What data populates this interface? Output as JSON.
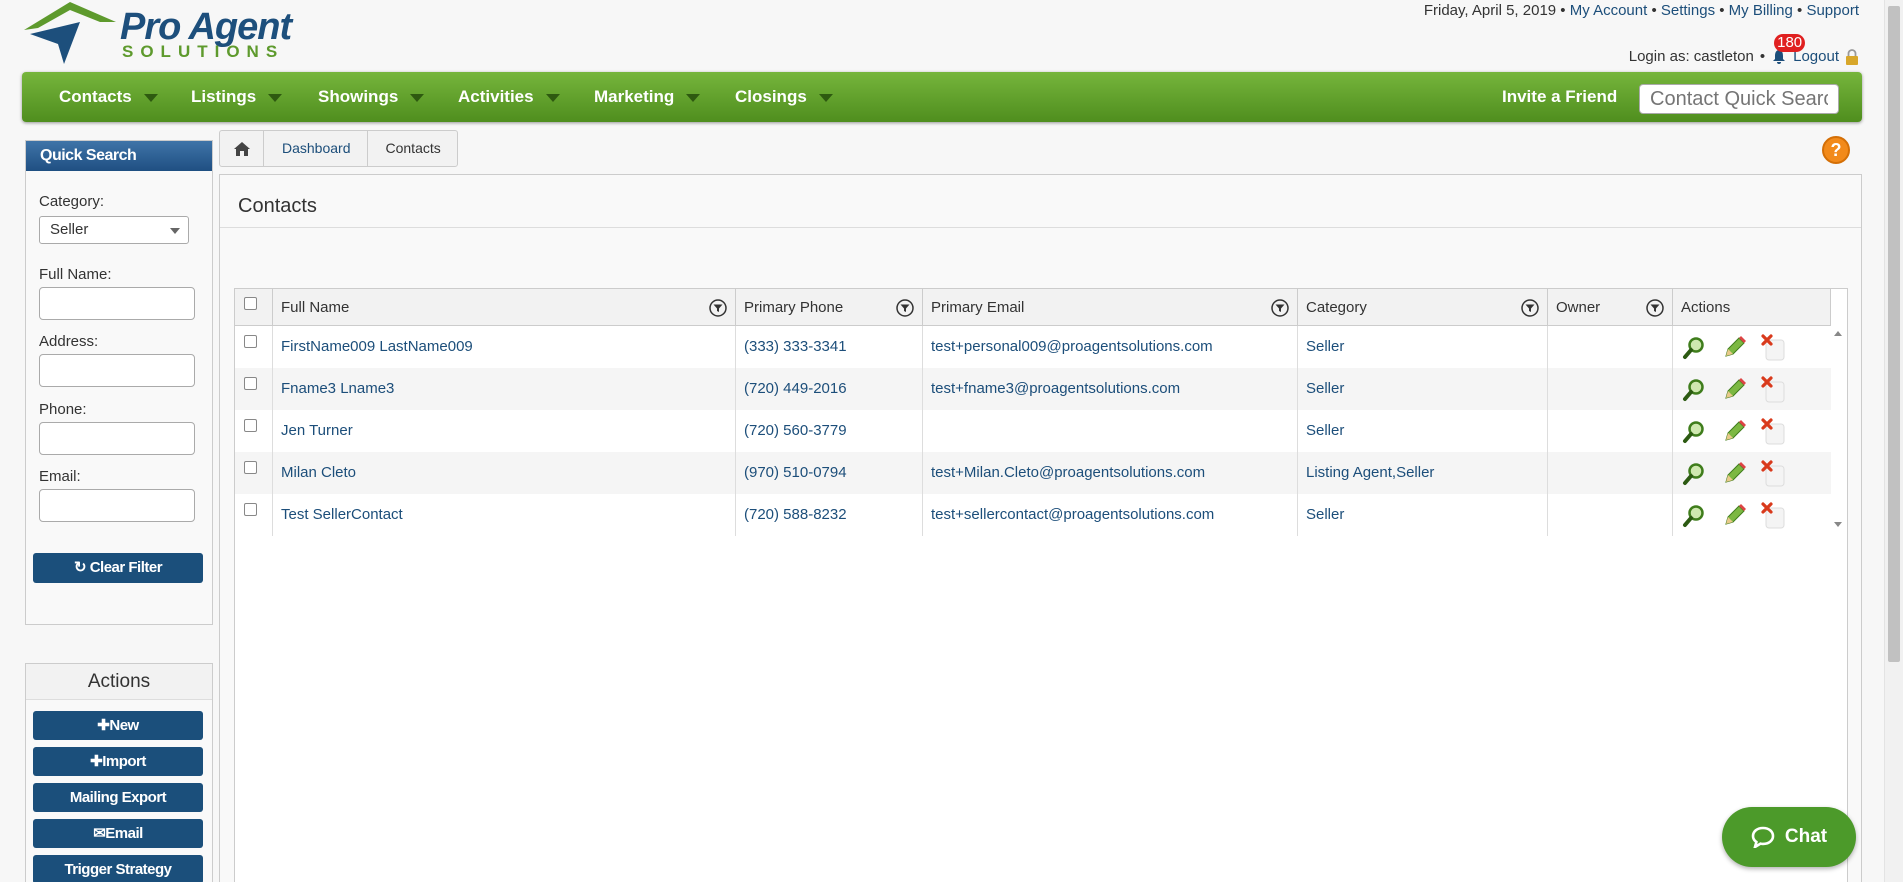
{
  "header": {
    "logo_name": "Pro Agent",
    "logo_sub": "SOLUTIONS",
    "date": "Friday, April 5, 2019",
    "links": [
      "My Account",
      "Settings",
      "My Billing",
      "Support"
    ],
    "login_text": "Login as: castleton",
    "notification_count": "180",
    "logout": "Logout"
  },
  "nav": {
    "items": [
      "Contacts",
      "Listings",
      "Showings",
      "Activities",
      "Marketing",
      "Closings"
    ],
    "invite": "Invite a Friend",
    "search_placeholder": "Contact Quick Search"
  },
  "quick_search": {
    "title": "Quick Search",
    "category_label": "Category:",
    "category_value": "Seller",
    "fullname_label": "Full Name:",
    "address_label": "Address:",
    "phone_label": "Phone:",
    "email_label": "Email:",
    "clear_filter": "Clear Filter"
  },
  "actions": {
    "title": "Actions",
    "new": "New",
    "import": "Import",
    "mailing_export": "Mailing Export",
    "email": "Email",
    "trigger_strategy": "Trigger Strategy"
  },
  "breadcrumb": [
    "Dashboard",
    "Contacts"
  ],
  "help_symbol": "?",
  "page_title": "Contacts",
  "grid": {
    "columns": [
      "Full Name",
      "Primary Phone",
      "Primary Email",
      "Category",
      "Owner",
      "Actions"
    ],
    "rows": [
      {
        "name": "FirstName009 LastName009",
        "phone": "(333) 333-3341",
        "email": "test+personal009@proagentsolutions.com",
        "category": "Seller",
        "owner": ""
      },
      {
        "name": "Fname3 Lname3",
        "phone": "(720) 449-2016",
        "email": "test+fname3@proagentsolutions.com",
        "category": "Seller",
        "owner": ""
      },
      {
        "name": "Jen Turner",
        "phone": "(720) 560-3779",
        "email": "",
        "category": "Seller",
        "owner": ""
      },
      {
        "name": "Milan Cleto",
        "phone": "(970) 510-0794",
        "email": "test+Milan.Cleto@proagentsolutions.com",
        "category": "Listing Agent,Seller",
        "owner": ""
      },
      {
        "name": "Test SellerContact",
        "phone": "(720) 588-8232",
        "email": "test+sellercontact@proagentsolutions.com",
        "category": "Seller",
        "owner": ""
      }
    ]
  },
  "chat": "Chat",
  "colors": {
    "nav_green": "#5e9a2d",
    "link_blue": "#1c4e7a",
    "button_blue": "#1b4f7b",
    "help_orange": "#f28a1a",
    "badge_red": "#e02020"
  }
}
